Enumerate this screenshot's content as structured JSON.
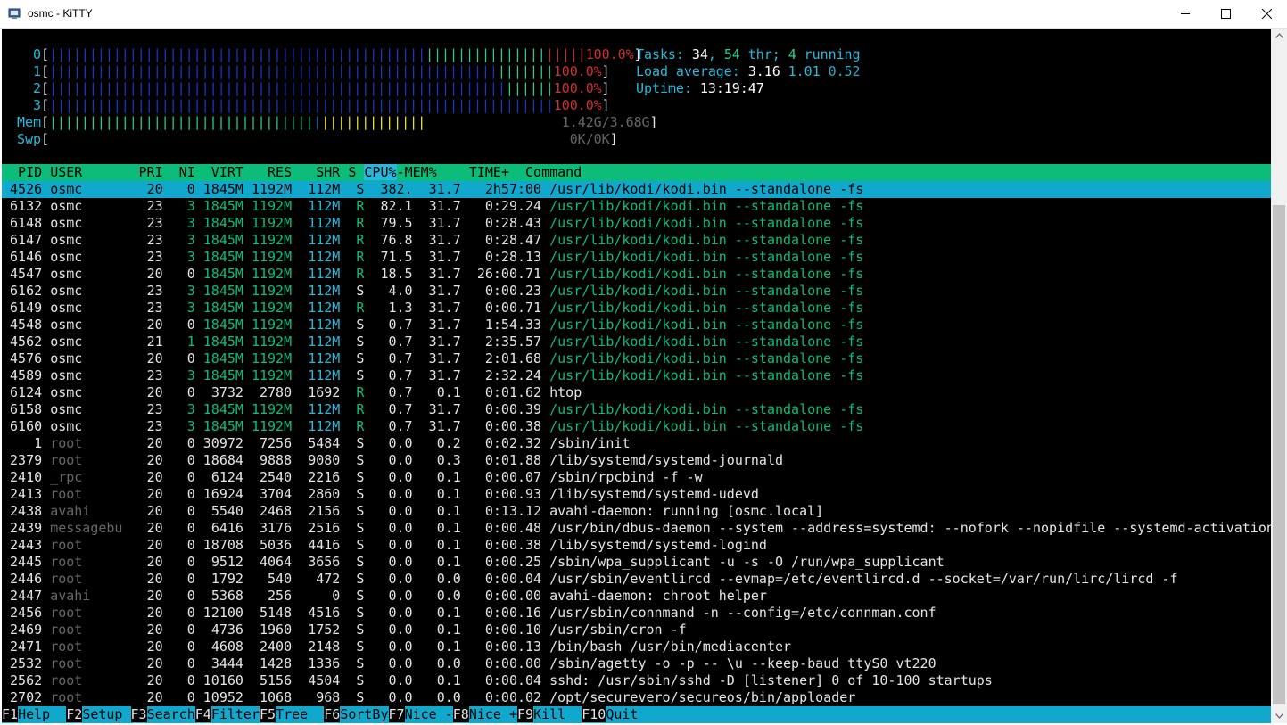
{
  "window": {
    "title": "osmc - KiTTY"
  },
  "meters": {
    "cpus": [
      {
        "label": "0",
        "percent": "100.0%"
      },
      {
        "label": "1",
        "percent": "100.0%"
      },
      {
        "label": "2",
        "percent": "100.0%"
      },
      {
        "label": "3",
        "percent": "100.0%"
      }
    ],
    "mem": {
      "label": "Mem",
      "value": "1.42G/3.68G"
    },
    "swp": {
      "label": "Swp",
      "value": "0K/0K"
    }
  },
  "summary": {
    "tasks_label": "Tasks:",
    "tasks": "34",
    "thr": "54",
    "thr_label": "thr;",
    "running": "4",
    "running_label": "running",
    "load_label": "Load average:",
    "load1": "3.16",
    "load5": "1.01",
    "load15": "0.52",
    "uptime_label": "Uptime:",
    "uptime": "13:19:47"
  },
  "table": {
    "columns": {
      "pid": "  PID",
      "user": "USER     ",
      "pri": "  PRI",
      "ni": "  NI",
      "virt": "  VIRT",
      "res": "   RES",
      "shr": "   SHR",
      "s": "S",
      "cpu": "CPU%",
      "mem": "MEM%",
      "time": "   TIME+ ",
      "cmd": "Command"
    },
    "selected": {
      "pid": "4526",
      "user": "osmc",
      "pri": "20",
      "ni": "0",
      "virt": "1845M",
      "res": "1192M",
      "shr": "112M",
      "s": "S",
      "cpu": "382.",
      "mem": "31.7",
      "time": "2h57:00",
      "cmd": "/usr/lib/kodi/kodi.bin --standalone -fs"
    },
    "rows": [
      {
        "pid": "6132",
        "user": "osmc",
        "pri": "23",
        "ni": "3",
        "virt": "1845M",
        "res": "1192M",
        "shr": "112M",
        "s": "R",
        "cpu": "82.1",
        "mem": "31.7",
        "time": "0:29.24",
        "cmd": "/usr/lib/kodi/kodi.bin --standalone -fs",
        "kind": "thread"
      },
      {
        "pid": "6148",
        "user": "osmc",
        "pri": "23",
        "ni": "3",
        "virt": "1845M",
        "res": "1192M",
        "shr": "112M",
        "s": "R",
        "cpu": "79.5",
        "mem": "31.7",
        "time": "0:28.43",
        "cmd": "/usr/lib/kodi/kodi.bin --standalone -fs",
        "kind": "thread"
      },
      {
        "pid": "6147",
        "user": "osmc",
        "pri": "23",
        "ni": "3",
        "virt": "1845M",
        "res": "1192M",
        "shr": "112M",
        "s": "R",
        "cpu": "76.8",
        "mem": "31.7",
        "time": "0:28.47",
        "cmd": "/usr/lib/kodi/kodi.bin --standalone -fs",
        "kind": "thread"
      },
      {
        "pid": "6146",
        "user": "osmc",
        "pri": "23",
        "ni": "3",
        "virt": "1845M",
        "res": "1192M",
        "shr": "112M",
        "s": "R",
        "cpu": "71.5",
        "mem": "31.7",
        "time": "0:28.13",
        "cmd": "/usr/lib/kodi/kodi.bin --standalone -fs",
        "kind": "thread"
      },
      {
        "pid": "4547",
        "user": "osmc",
        "pri": "20",
        "ni": "0",
        "virt": "1845M",
        "res": "1192M",
        "shr": "112M",
        "s": "R",
        "cpu": "18.5",
        "mem": "31.7",
        "time": "26:00.71",
        "cmd": "/usr/lib/kodi/kodi.bin --standalone -fs",
        "kind": "thread"
      },
      {
        "pid": "6162",
        "user": "osmc",
        "pri": "23",
        "ni": "3",
        "virt": "1845M",
        "res": "1192M",
        "shr": "112M",
        "s": "S",
        "cpu": "4.0",
        "mem": "31.7",
        "time": "0:00.23",
        "cmd": "/usr/lib/kodi/kodi.bin --standalone -fs",
        "kind": "thread"
      },
      {
        "pid": "6149",
        "user": "osmc",
        "pri": "23",
        "ni": "3",
        "virt": "1845M",
        "res": "1192M",
        "shr": "112M",
        "s": "R",
        "cpu": "1.3",
        "mem": "31.7",
        "time": "0:00.71",
        "cmd": "/usr/lib/kodi/kodi.bin --standalone -fs",
        "kind": "thread"
      },
      {
        "pid": "4548",
        "user": "osmc",
        "pri": "20",
        "ni": "0",
        "virt": "1845M",
        "res": "1192M",
        "shr": "112M",
        "s": "S",
        "cpu": "0.7",
        "mem": "31.7",
        "time": "1:54.33",
        "cmd": "/usr/lib/kodi/kodi.bin --standalone -fs",
        "kind": "thread"
      },
      {
        "pid": "4562",
        "user": "osmc",
        "pri": "21",
        "ni": "1",
        "virt": "1845M",
        "res": "1192M",
        "shr": "112M",
        "s": "S",
        "cpu": "0.7",
        "mem": "31.7",
        "time": "2:35.57",
        "cmd": "/usr/lib/kodi/kodi.bin --standalone -fs",
        "kind": "thread"
      },
      {
        "pid": "4576",
        "user": "osmc",
        "pri": "20",
        "ni": "0",
        "virt": "1845M",
        "res": "1192M",
        "shr": "112M",
        "s": "S",
        "cpu": "0.7",
        "mem": "31.7",
        "time": "2:01.68",
        "cmd": "/usr/lib/kodi/kodi.bin --standalone -fs",
        "kind": "thread"
      },
      {
        "pid": "4589",
        "user": "osmc",
        "pri": "23",
        "ni": "3",
        "virt": "1845M",
        "res": "1192M",
        "shr": "112M",
        "s": "S",
        "cpu": "0.7",
        "mem": "31.7",
        "time": "2:32.24",
        "cmd": "/usr/lib/kodi/kodi.bin --standalone -fs",
        "kind": "thread"
      },
      {
        "pid": "6124",
        "user": "osmc",
        "pri": "20",
        "ni": "0",
        "virt": "3732",
        "res": "2780",
        "shr": "1692",
        "s": "R",
        "cpu": "0.7",
        "mem": "0.1",
        "time": "0:01.62",
        "cmd": "htop",
        "kind": "proc"
      },
      {
        "pid": "6158",
        "user": "osmc",
        "pri": "23",
        "ni": "3",
        "virt": "1845M",
        "res": "1192M",
        "shr": "112M",
        "s": "R",
        "cpu": "0.7",
        "mem": "31.7",
        "time": "0:00.39",
        "cmd": "/usr/lib/kodi/kodi.bin --standalone -fs",
        "kind": "thread"
      },
      {
        "pid": "6160",
        "user": "osmc",
        "pri": "23",
        "ni": "3",
        "virt": "1845M",
        "res": "1192M",
        "shr": "112M",
        "s": "R",
        "cpu": "0.7",
        "mem": "31.7",
        "time": "0:00.38",
        "cmd": "/usr/lib/kodi/kodi.bin --standalone -fs",
        "kind": "thread"
      },
      {
        "pid": "1",
        "user": "root",
        "pri": "20",
        "ni": "0",
        "virt": "30972",
        "res": "7256",
        "shr": "5484",
        "s": "S",
        "cpu": "0.0",
        "mem": "0.2",
        "time": "0:02.32",
        "cmd": "/sbin/init",
        "kind": "other"
      },
      {
        "pid": "2379",
        "user": "root",
        "pri": "20",
        "ni": "0",
        "virt": "18684",
        "res": "9888",
        "shr": "9080",
        "s": "S",
        "cpu": "0.0",
        "mem": "0.3",
        "time": "0:01.88",
        "cmd": "/lib/systemd/systemd-journald",
        "kind": "other"
      },
      {
        "pid": "2410",
        "user": "_rpc",
        "pri": "20",
        "ni": "0",
        "virt": "6124",
        "res": "2540",
        "shr": "2216",
        "s": "S",
        "cpu": "0.0",
        "mem": "0.1",
        "time": "0:00.07",
        "cmd": "/sbin/rpcbind -f -w",
        "kind": "other"
      },
      {
        "pid": "2413",
        "user": "root",
        "pri": "20",
        "ni": "0",
        "virt": "16924",
        "res": "3704",
        "shr": "2860",
        "s": "S",
        "cpu": "0.0",
        "mem": "0.1",
        "time": "0:00.93",
        "cmd": "/lib/systemd/systemd-udevd",
        "kind": "other"
      },
      {
        "pid": "2438",
        "user": "avahi",
        "pri": "20",
        "ni": "0",
        "virt": "5540",
        "res": "2468",
        "shr": "2156",
        "s": "S",
        "cpu": "0.0",
        "mem": "0.1",
        "time": "0:13.12",
        "cmd": "avahi-daemon: running [osmc.local]",
        "kind": "other"
      },
      {
        "pid": "2439",
        "user": "messagebu",
        "pri": "20",
        "ni": "0",
        "virt": "6416",
        "res": "3176",
        "shr": "2516",
        "s": "S",
        "cpu": "0.0",
        "mem": "0.1",
        "time": "0:00.48",
        "cmd": "/usr/bin/dbus-daemon --system --address=systemd: --nofork --nopidfile --systemd-activation --sy",
        "kind": "other"
      },
      {
        "pid": "2443",
        "user": "root",
        "pri": "20",
        "ni": "0",
        "virt": "18708",
        "res": "5036",
        "shr": "4416",
        "s": "S",
        "cpu": "0.0",
        "mem": "0.1",
        "time": "0:00.38",
        "cmd": "/lib/systemd/systemd-logind",
        "kind": "other"
      },
      {
        "pid": "2445",
        "user": "root",
        "pri": "20",
        "ni": "0",
        "virt": "9512",
        "res": "4064",
        "shr": "3656",
        "s": "S",
        "cpu": "0.0",
        "mem": "0.1",
        "time": "0:00.25",
        "cmd": "/sbin/wpa_supplicant -u -s -O /run/wpa_supplicant",
        "kind": "other"
      },
      {
        "pid": "2446",
        "user": "root",
        "pri": "20",
        "ni": "0",
        "virt": "1792",
        "res": "540",
        "shr": "472",
        "s": "S",
        "cpu": "0.0",
        "mem": "0.0",
        "time": "0:00.04",
        "cmd": "/usr/sbin/eventlircd --evmap=/etc/eventlircd.d --socket=/var/run/lirc/lircd -f",
        "kind": "other"
      },
      {
        "pid": "2447",
        "user": "avahi",
        "pri": "20",
        "ni": "0",
        "virt": "5368",
        "res": "256",
        "shr": "0",
        "s": "S",
        "cpu": "0.0",
        "mem": "0.0",
        "time": "0:00.00",
        "cmd": "avahi-daemon: chroot helper",
        "kind": "other"
      },
      {
        "pid": "2456",
        "user": "root",
        "pri": "20",
        "ni": "0",
        "virt": "12100",
        "res": "5148",
        "shr": "4516",
        "s": "S",
        "cpu": "0.0",
        "mem": "0.1",
        "time": "0:00.16",
        "cmd": "/usr/sbin/connmand -n --config=/etc/connman.conf",
        "kind": "other"
      },
      {
        "pid": "2469",
        "user": "root",
        "pri": "20",
        "ni": "0",
        "virt": "4736",
        "res": "1960",
        "shr": "1752",
        "s": "S",
        "cpu": "0.0",
        "mem": "0.1",
        "time": "0:00.10",
        "cmd": "/usr/sbin/cron -f",
        "kind": "other"
      },
      {
        "pid": "2471",
        "user": "root",
        "pri": "20",
        "ni": "0",
        "virt": "4608",
        "res": "2400",
        "shr": "2148",
        "s": "S",
        "cpu": "0.0",
        "mem": "0.1",
        "time": "0:00.13",
        "cmd": "/bin/bash /usr/bin/mediacenter",
        "kind": "other"
      },
      {
        "pid": "2532",
        "user": "root",
        "pri": "20",
        "ni": "0",
        "virt": "3444",
        "res": "1428",
        "shr": "1336",
        "s": "S",
        "cpu": "0.0",
        "mem": "0.0",
        "time": "0:00.00",
        "cmd": "/sbin/agetty -o -p -- \\u --keep-baud ttyS0 vt220",
        "kind": "other"
      },
      {
        "pid": "2562",
        "user": "root",
        "pri": "20",
        "ni": "0",
        "virt": "10160",
        "res": "5156",
        "shr": "4504",
        "s": "S",
        "cpu": "0.0",
        "mem": "0.1",
        "time": "0:00.04",
        "cmd": "sshd: /usr/sbin/sshd -D [listener] 0 of 10-100 startups",
        "kind": "other"
      },
      {
        "pid": "2702",
        "user": "root",
        "pri": "20",
        "ni": "0",
        "virt": "10952",
        "res": "1068",
        "shr": "968",
        "s": "S",
        "cpu": "0.0",
        "mem": "0.0",
        "time": "0:00.02",
        "cmd": "/opt/securevero/secureos/bin/apploader",
        "kind": "other"
      }
    ]
  },
  "fkeys": [
    {
      "key": "F1",
      "label": "Help  "
    },
    {
      "key": "F2",
      "label": "Setup "
    },
    {
      "key": "F3",
      "label": "Search"
    },
    {
      "key": "F4",
      "label": "Filter"
    },
    {
      "key": "F5",
      "label": "Tree  "
    },
    {
      "key": "F6",
      "label": "SortBy"
    },
    {
      "key": "F7",
      "label": "Nice -"
    },
    {
      "key": "F8",
      "label": "Nice +"
    },
    {
      "key": "F9",
      "label": "Kill  "
    },
    {
      "key": "F10",
      "label": "Quit"
    }
  ],
  "icons": {
    "app": "kitty-terminal-icon",
    "minimize": "minimize-icon",
    "maximize": "maximize-icon",
    "close": "close-icon"
  },
  "colors": {
    "header_bg": "#0dbc79",
    "selected_bg": "#11a8cd",
    "thread_text": "#0dbc79",
    "cpu_bar_red": "#cd3131",
    "mem_bar_yellow": "#e5e510"
  }
}
